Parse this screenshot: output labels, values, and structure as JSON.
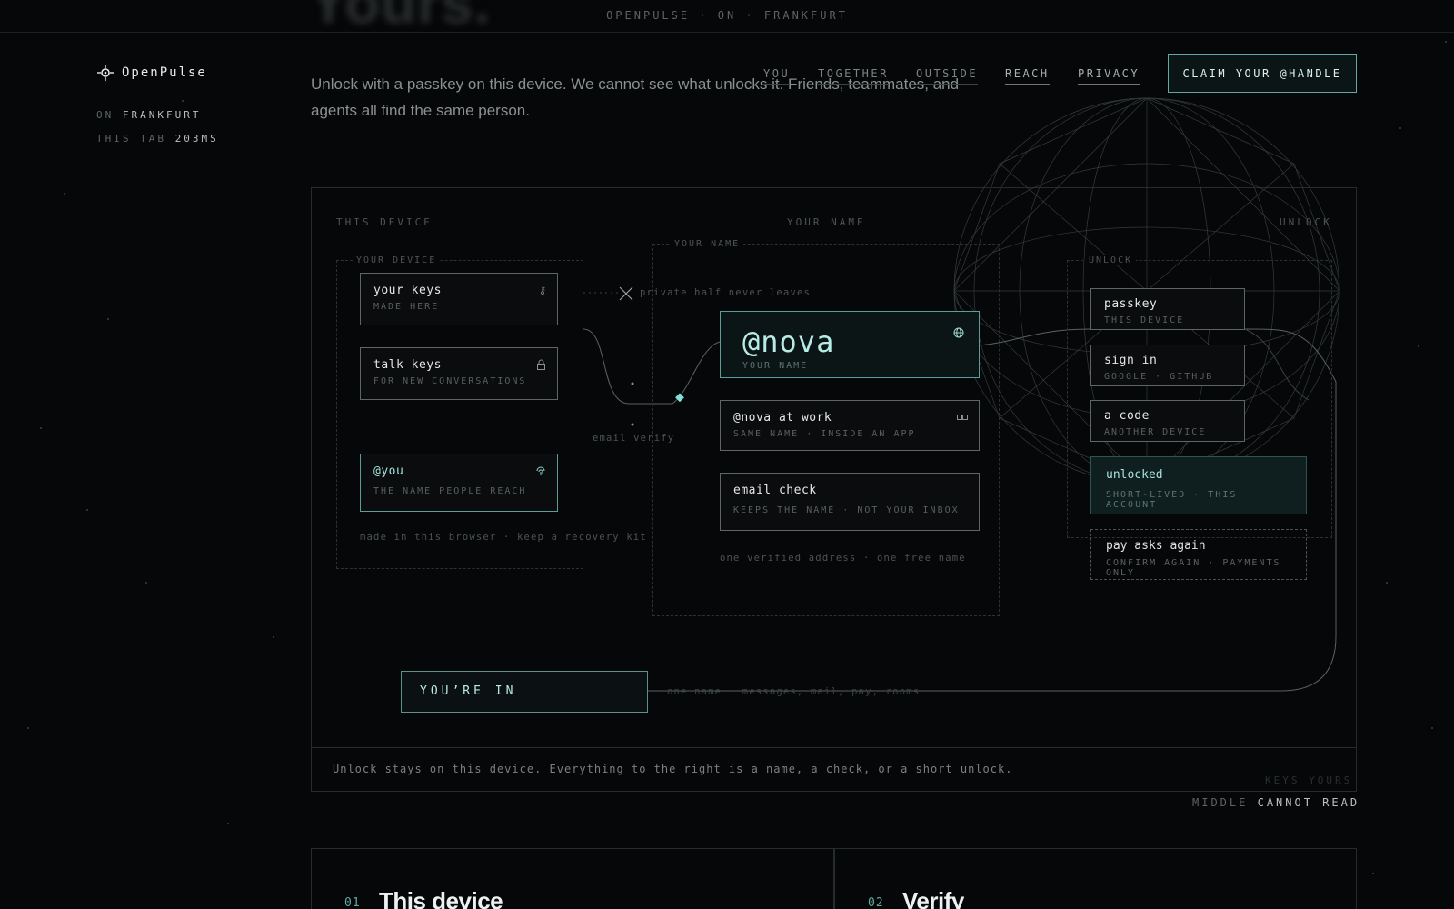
{
  "status_bar": {
    "text": "OPENPULSE · ON · FRANKFURT",
    "ghost_word": "Yours."
  },
  "brand": {
    "name": "OpenPulse",
    "region_label": "ON",
    "region_value": "FRANKFURT",
    "latency_label": "THIS TAB",
    "latency_value": "203MS"
  },
  "intro": "Unlock with a passkey on this device. We cannot see what unlocks it. Friends, teammates, and agents all find the same person.",
  "nav": {
    "items": [
      "YOU",
      "TOGETHER",
      "OUTSIDE",
      "REACH",
      "PRIVACY"
    ],
    "cta": "CLAIM YOUR @HANDLE"
  },
  "diagram": {
    "columns": [
      "THIS DEVICE",
      "YOUR NAME",
      "UNLOCK"
    ],
    "device": {
      "box_label": "YOUR DEVICE",
      "cards": [
        {
          "title": "your keys",
          "sub": "MADE HERE",
          "icon": "key-icon"
        },
        {
          "title": "talk keys",
          "sub": "FOR NEW CONVERSATIONS",
          "icon": "lock-icon"
        },
        {
          "title": "@you",
          "sub": "THE NAME PEOPLE REACH",
          "icon": "fingerprint-icon"
        }
      ],
      "note": "made in this browser · keep a recovery kit"
    },
    "private_note": "private half never leaves",
    "email_verify": "email verify",
    "name": {
      "box_label": "YOUR NAME",
      "handle": "@nova",
      "handle_sub": "YOUR NAME",
      "cards": [
        {
          "title": "@nova at work",
          "sub": "SAME NAME · INSIDE AN APP",
          "icon": "link-icon"
        },
        {
          "title": "email check",
          "sub": "KEEPS THE NAME · NOT YOUR INBOX"
        }
      ],
      "note": "one verified address · one free name"
    },
    "unlock": {
      "box_label": "UNLOCK",
      "cards": [
        {
          "title": "passkey",
          "sub": "THIS DEVICE"
        },
        {
          "title": "sign in",
          "sub": "GOOGLE · GITHUB"
        },
        {
          "title": "a code",
          "sub": "ANOTHER DEVICE"
        }
      ],
      "unlocked": {
        "title": "unlocked",
        "sub": "SHORT-LIVED · THIS ACCOUNT"
      },
      "pay": {
        "title": "pay asks again",
        "sub": "CONFIRM AGAIN · PAYMENTS ONLY"
      }
    },
    "youre_in": "YOU’RE IN",
    "youre_in_note": "one name · messages, mail, pay, rooms",
    "footer": "Unlock stays on this device. Everything to the right is a name, a check, or a short unlock."
  },
  "tags": {
    "keys": "KEYS YOURS",
    "middle_a": "MIDDLE",
    "middle_b": "CANNOT READ"
  },
  "steps": [
    {
      "num": "01",
      "title": "This device"
    },
    {
      "num": "02",
      "title": "Verify"
    }
  ],
  "colors": {
    "accent": "#5fa9a2",
    "background": "#060708"
  }
}
